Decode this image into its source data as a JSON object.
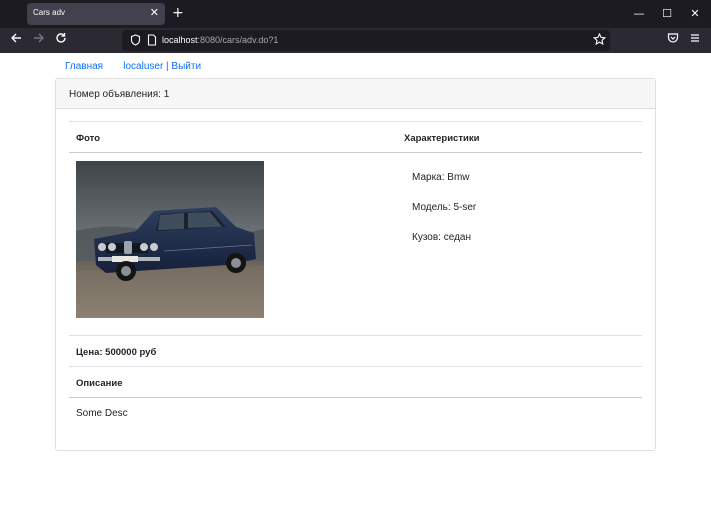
{
  "browser": {
    "tab_title": "Cars adv",
    "url_host": "localhost",
    "url_rest": ":8080/cars/adv.do?1"
  },
  "nav": {
    "home_label": "Главная",
    "user_label": "localuser | Выйти"
  },
  "card": {
    "header": "Номер объявления: 1",
    "photo_header": "Фото",
    "specs_header": "Характеристики",
    "brand": "Марка: Bmw",
    "model": "Модель: 5-ser",
    "body": "Кузов: седан",
    "price": "Цена: 500000 руб",
    "description_header": "Описание",
    "description": "Some Desc"
  },
  "photo": {
    "alt": "BMW 5-series sedan photo",
    "plate": "M·HK 5331"
  },
  "colors": {
    "link": "#0d6efd",
    "chrome_dark": "#1c1b22",
    "chrome_toolbar": "#2b2a33"
  },
  "icons": [
    "back-arrow-icon",
    "forward-arrow-icon",
    "reload-icon",
    "shield-icon",
    "page-icon",
    "star-icon",
    "pocket-icon",
    "menu-icon"
  ]
}
